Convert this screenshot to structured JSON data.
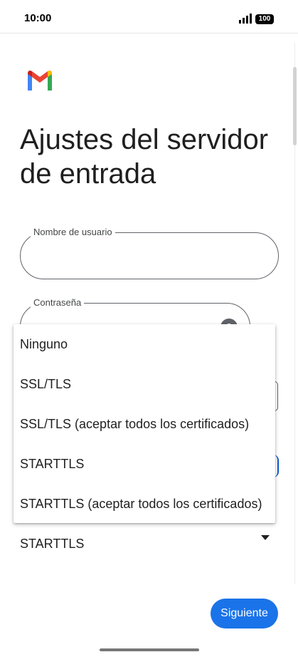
{
  "status_bar": {
    "time": "10:00",
    "battery": "100"
  },
  "page": {
    "title": "Ajustes del servidor de entrada"
  },
  "form": {
    "username_label": "Nombre de usuario",
    "password_label": "Contraseña",
    "security_value": "STARTTLS"
  },
  "dropdown": {
    "options": [
      "Ninguno",
      "SSL/TLS",
      "SSL/TLS (aceptar todos los certificados)",
      "STARTTLS",
      "STARTTLS (aceptar todos los certificados)"
    ]
  },
  "actions": {
    "next_label": "Siguiente"
  },
  "colors": {
    "accent": "#1a73e8",
    "gmail_red": "#ea4335",
    "gmail_blue": "#4285f4",
    "gmail_green": "#34a853",
    "gmail_yellow": "#fbbc04"
  },
  "icons": [
    "gmail-logo-icon",
    "signal-icon",
    "battery-icon",
    "eye-icon",
    "caret-down-icon"
  ]
}
